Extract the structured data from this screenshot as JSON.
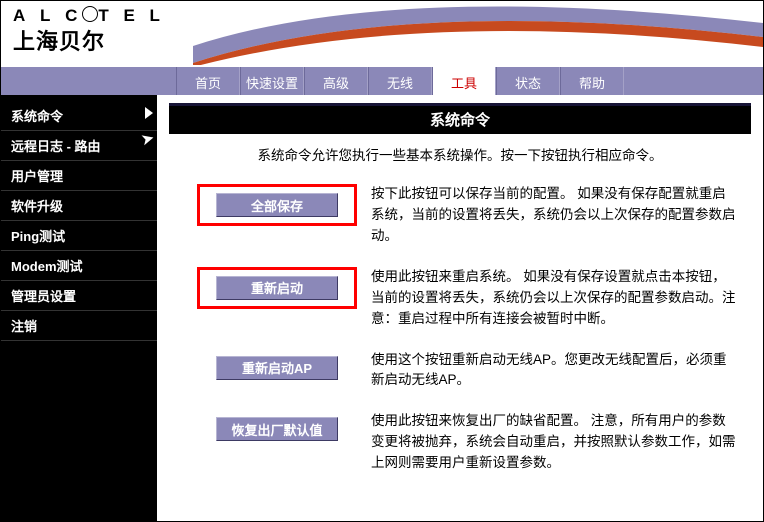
{
  "brand": {
    "top": "ALCATEL",
    "bottom": "上海贝尔"
  },
  "tabs": [
    {
      "label": "首页"
    },
    {
      "label": "快速设置"
    },
    {
      "label": "高级"
    },
    {
      "label": "无线"
    },
    {
      "label": "工具",
      "active": true
    },
    {
      "label": "状态"
    },
    {
      "label": "帮助"
    }
  ],
  "sidebar": [
    {
      "label": "系统命令",
      "active": true
    },
    {
      "label": "远程日志 - 路由"
    },
    {
      "label": "用户管理"
    },
    {
      "label": "软件升级"
    },
    {
      "label": "Ping测试"
    },
    {
      "label": "Modem测试"
    },
    {
      "label": "管理员设置"
    },
    {
      "label": "注销"
    }
  ],
  "content": {
    "title": "系统命令",
    "subtitle": "系统命令允许您执行一些基本系统操作。按一下按钮执行相应命令。",
    "rows": [
      {
        "button": "全部保存",
        "highlight": true,
        "text": "按下此按钮可以保存当前的配置。 如果没有保存配置就重启系统，当前的设置将丢失，系统仍会以上次保存的配置参数启动。"
      },
      {
        "button": "重新启动",
        "highlight": true,
        "text": "使用此按钮来重启系统。 如果没有保存设置就点击本按钮，当前的设置将丢失，系统仍会以上次保存的配置参数启动。注意：重启过程中所有连接会被暂时中断。"
      },
      {
        "button": "重新启动AP",
        "highlight": false,
        "text": "使用这个按钮重新启动无线AP。您更改无线配置后，必须重新启动无线AP。"
      },
      {
        "button": "恢复出厂默认值",
        "highlight": false,
        "text": "使用此按钮来恢复出厂的缺省配置。 注意，所有用户的参数变更将被抛弃，系统会自动重启，并按照默认参数工作，如需上网则需要用户重新设置参数。"
      }
    ]
  }
}
